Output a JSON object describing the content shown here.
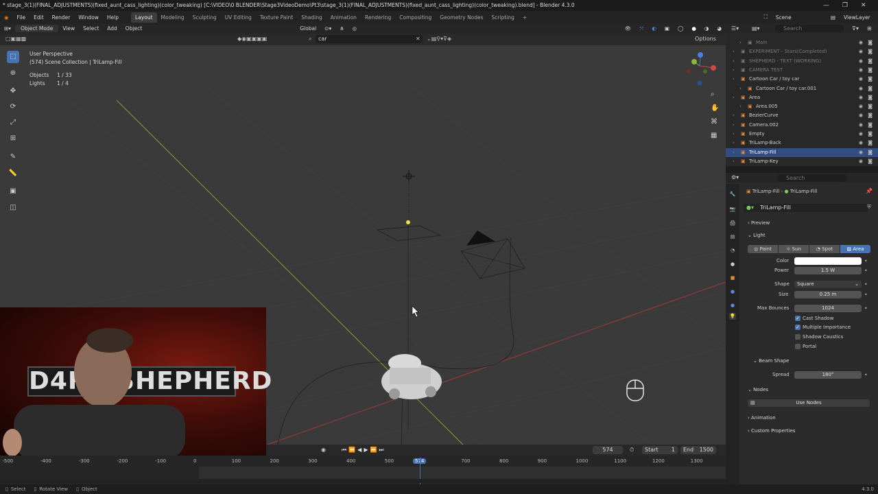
{
  "window": {
    "title": "* stage_3(1)(FINAL_ADJUSTMENTS)(fixed_aunt_cass_lighting)(color_tweaking) [C:\\VIDEO\\0 BLENDER\\Stage3VideoDemo\\Pt3\\stage_3(1)(FINAL_ADJUSTMENTS)(fixed_aunt_cass_lighting)(color_tweaking).blend] - Blender 4.3.0",
    "min": "—",
    "max": "❐",
    "close": "✕"
  },
  "menu": [
    "File",
    "Edit",
    "Render",
    "Window",
    "Help"
  ],
  "workspaces": [
    "Layout",
    "Modeling",
    "Sculpting",
    "UV Editing",
    "Texture Paint",
    "Shading",
    "Animation",
    "Rendering",
    "Compositing",
    "Geometry Nodes",
    "Scripting"
  ],
  "workspace_add": "+",
  "scene": {
    "label": "Scene",
    "viewlayer": "ViewLayer"
  },
  "viewport_header": {
    "mode": "Object Mode",
    "menus": [
      "View",
      "Select",
      "Add",
      "Object"
    ],
    "orientation": "Global",
    "search_value": "car",
    "options": "Options"
  },
  "viewport_overlay": {
    "view_name": "User Perspective",
    "collection": "(574) Scene Collection | TriLamp-Fill",
    "objects_label": "Objects",
    "objects_value": "1 / 33",
    "lights_label": "Lights",
    "lights_value": "1 / 4"
  },
  "webcam": {
    "logo_text": "D4RK SHEPHERD"
  },
  "outliner": {
    "search_placeholder": "Search",
    "rows": [
      {
        "label": "Main",
        "dim": true,
        "indent": 2
      },
      {
        "label": "EXPERIMENT - Stars(Completed)",
        "dim": true,
        "indent": 1
      },
      {
        "label": "SHEPHERD - TEXT (WORKING)",
        "dim": true,
        "indent": 1
      },
      {
        "label": "CAMERA TEST",
        "dim": true,
        "indent": 1
      },
      {
        "label": "Cartoon Car / toy car",
        "dim": false,
        "indent": 1
      },
      {
        "label": "Cartoon Car / toy car.001",
        "dim": false,
        "indent": 2
      },
      {
        "label": "Area",
        "dim": false,
        "indent": 1
      },
      {
        "label": "Area.005",
        "dim": false,
        "indent": 2
      },
      {
        "label": "BezierCurve",
        "dim": false,
        "indent": 1
      },
      {
        "label": "Camera.002",
        "dim": false,
        "indent": 1
      },
      {
        "label": "Empty",
        "dim": false,
        "indent": 1
      },
      {
        "label": "TriLamp-Back",
        "dim": false,
        "indent": 1
      },
      {
        "label": "TriLamp-Fill",
        "dim": false,
        "indent": 1,
        "selected": true
      },
      {
        "label": "TriLamp-Key",
        "dim": false,
        "indent": 1
      }
    ]
  },
  "properties": {
    "search_placeholder": "Search",
    "breadcrumb_object": "TriLamp-Fill",
    "breadcrumb_data": "TriLamp-Fill",
    "datablock_name": "TriLamp-Fill",
    "preview": "Preview",
    "light": "Light",
    "light_types": [
      "Point",
      "Sun",
      "Spot",
      "Area"
    ],
    "selected_light_type": "Area",
    "color_label": "Color",
    "color_value": "#ffffff",
    "power_label": "Power",
    "power_value": "1.5 W",
    "shape_label": "Shape",
    "shape_value": "Square",
    "size_label": "Size",
    "size_value": "0.25 m",
    "max_bounces_label": "Max Bounces",
    "max_bounces_value": "1024",
    "cast_shadow": "Cast Shadow",
    "multiple_importance": "Multiple Importance",
    "shadow_caustics": "Shadow Caustics",
    "portal": "Portal",
    "beam_shape": "Beam Shape",
    "spread_label": "Spread",
    "spread_value": "180°",
    "nodes": "Nodes",
    "use_nodes": "Use Nodes",
    "animation": "Animation",
    "custom_properties": "Custom Properties"
  },
  "timeline": {
    "current_frame": "574",
    "start_label": "Start",
    "start_value": "1",
    "end_label": "End",
    "end_value": "1500",
    "ticks": [
      "-500",
      "-400",
      "-300",
      "-200",
      "-100",
      "0",
      "100",
      "200",
      "300",
      "400",
      "500",
      "574",
      "700",
      "800",
      "900",
      "1000",
      "1100",
      "1200",
      "1300"
    ]
  },
  "status": {
    "select": "Select",
    "rotate": "Rotate View",
    "object": "Object",
    "version": "4.3.0"
  },
  "colors": {
    "accent": "#4772b3",
    "selection_row": "#334d80"
  }
}
